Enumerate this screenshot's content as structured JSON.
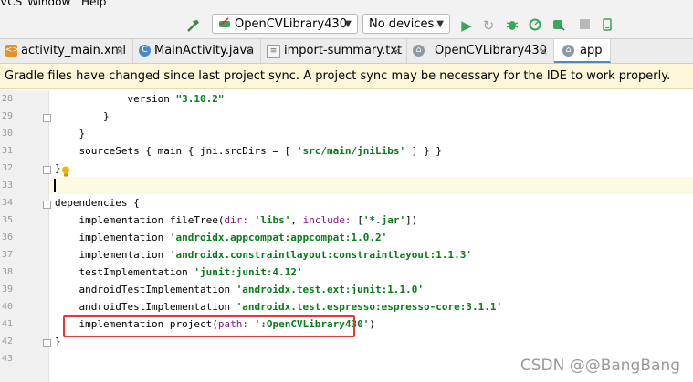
{
  "menu": {
    "items": [
      "VCS",
      "Window",
      "Help"
    ]
  },
  "toolbar": {
    "run_config": "OpenCVLibrary430",
    "device": "No devices",
    "icons": [
      "hammer-icon",
      "run-icon",
      "rerun-icon",
      "debug-icon",
      "profile-icon",
      "attach-debugger-icon",
      "stop-icon",
      "device-manager-icon"
    ]
  },
  "tabs": [
    {
      "label": "activity_main.xml",
      "icon": "xml-file-icon",
      "active": false
    },
    {
      "label": "MainActivity.java",
      "icon": "java-class-icon",
      "active": false
    },
    {
      "label": "import-summary.txt",
      "icon": "text-file-icon",
      "active": false
    },
    {
      "label": "OpenCVLibrary430",
      "icon": "gradle-icon",
      "active": false
    },
    {
      "label": "app",
      "icon": "gradle-icon",
      "active": true
    }
  ],
  "notification": {
    "text": "Gradle files have changed since last project sync. A project sync may be necessary for the IDE to work properly."
  },
  "editor": {
    "line_numbers": [
      "28",
      "29",
      "30",
      "31",
      "32",
      "33",
      "34",
      "35",
      "36",
      "37",
      "38",
      "39",
      "40",
      "41",
      "42",
      "43"
    ],
    "lines": [
      {
        "indent": "            ",
        "parts": [
          [
            "t",
            "version "
          ],
          [
            "s",
            "\"3.10.2\""
          ]
        ]
      },
      {
        "indent": "        ",
        "parts": [
          [
            "t",
            "}"
          ]
        ]
      },
      {
        "indent": "    ",
        "parts": [
          [
            "t",
            "}"
          ]
        ]
      },
      {
        "indent": "    ",
        "parts": [
          [
            "t",
            "sourceSets { main { jni.srcDirs = [ "
          ],
          [
            "s",
            "'src/main/jniLibs'"
          ],
          [
            "t",
            " ] } }"
          ]
        ]
      },
      {
        "indent": "",
        "parts": [
          [
            "t",
            "}"
          ]
        ]
      },
      {
        "indent": "",
        "parts": [
          [
            "t",
            ""
          ]
        ]
      },
      {
        "indent": "",
        "parts": [
          [
            "t",
            "dependencies {"
          ]
        ]
      },
      {
        "indent": "    ",
        "parts": [
          [
            "t",
            "implementation fileTree("
          ],
          [
            "p",
            "dir: "
          ],
          [
            "s",
            "'libs'"
          ],
          [
            "t",
            ", "
          ],
          [
            "p",
            "include: "
          ],
          [
            "t",
            "["
          ],
          [
            "s",
            "'*.jar'"
          ],
          [
            "t",
            "])"
          ]
        ]
      },
      {
        "indent": "    ",
        "parts": [
          [
            "t",
            "implementation "
          ],
          [
            "s",
            "'androidx.appcompat:appcompat:1.0.2'"
          ]
        ]
      },
      {
        "indent": "    ",
        "parts": [
          [
            "t",
            "implementation "
          ],
          [
            "s",
            "'androidx.constraintlayout:constraintlayout:1.1.3'"
          ]
        ]
      },
      {
        "indent": "    ",
        "parts": [
          [
            "t",
            "testImplementation "
          ],
          [
            "s",
            "'junit:junit:4.12'"
          ]
        ]
      },
      {
        "indent": "    ",
        "parts": [
          [
            "t",
            "androidTestImplementation "
          ],
          [
            "s",
            "'androidx.test.ext:junit:1.1.0'"
          ]
        ]
      },
      {
        "indent": "    ",
        "parts": [
          [
            "t",
            "androidTestImplementation "
          ],
          [
            "s",
            "'androidx.test.espresso:espresso-core:3.1.1'"
          ]
        ]
      },
      {
        "indent": "    ",
        "parts": [
          [
            "t",
            "implementation project("
          ],
          [
            "p",
            "path: "
          ],
          [
            "s",
            "':OpenCVLibrary430'"
          ],
          [
            "t",
            ")"
          ]
        ]
      },
      {
        "indent": "",
        "parts": [
          [
            "t",
            "}"
          ]
        ]
      },
      {
        "indent": "",
        "parts": [
          [
            "t",
            ""
          ]
        ]
      }
    ]
  },
  "watermark": "CSDN @@BangBang",
  "colors": {
    "string": "#067d17",
    "param": "#871094",
    "highlight_box": "#e53935",
    "notice_bg": "#fdf6d8"
  }
}
